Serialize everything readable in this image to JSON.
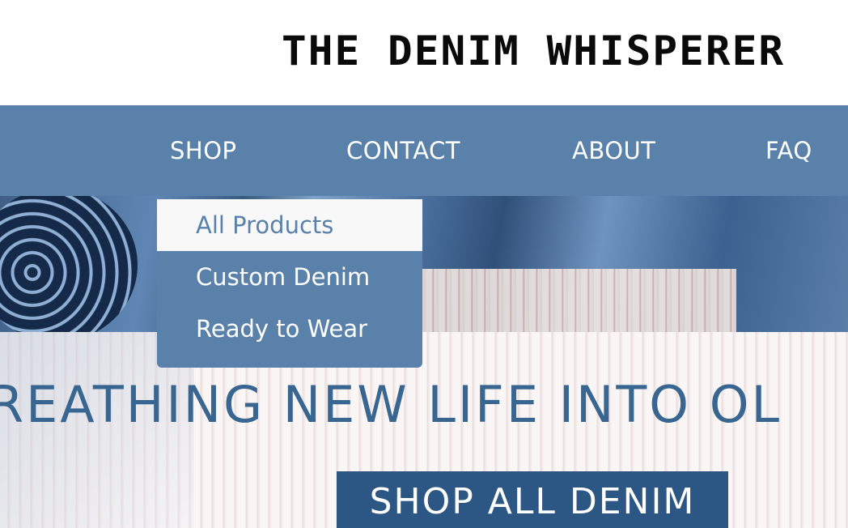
{
  "header": {
    "logo_text": "THE DENIM WHISPERER"
  },
  "nav": {
    "items": [
      {
        "label": "SHOP"
      },
      {
        "label": "CONTACT"
      },
      {
        "label": "ABOUT"
      },
      {
        "label": "FAQ"
      }
    ]
  },
  "dropdown": {
    "items": [
      {
        "label": "All Products",
        "state": "hovered"
      },
      {
        "label": "Custom Denim"
      },
      {
        "label": "Ready to Wear"
      }
    ]
  },
  "hero": {
    "heading": "REATHING NEW LIFE INTO OL",
    "cta_label": "SHOP ALL DENIM"
  },
  "colors": {
    "nav_bg": "#5a81a9",
    "heading_text": "#386691",
    "cta_bg": "#2c5683",
    "dropdown_active_bg": "#f8f8f8"
  }
}
